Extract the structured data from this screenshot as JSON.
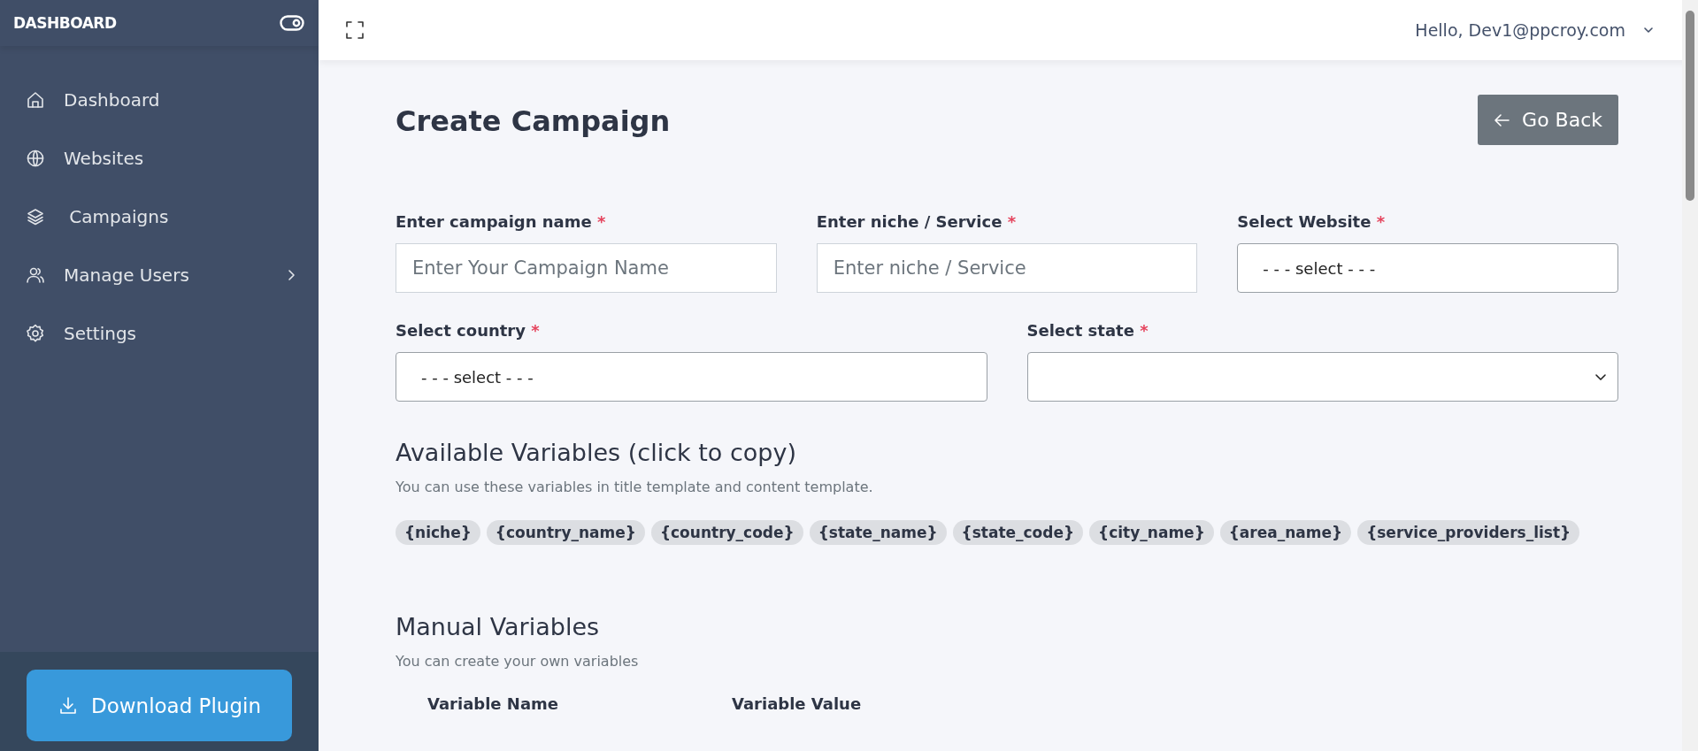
{
  "sidebar": {
    "brand": "DASHBOARD",
    "items": [
      {
        "label": "Dashboard",
        "expandable": false
      },
      {
        "label": "Websites",
        "expandable": false
      },
      {
        "label": " Campaigns",
        "expandable": false
      },
      {
        "label": "Manage Users",
        "expandable": true
      },
      {
        "label": "Settings",
        "expandable": false
      }
    ],
    "download_button": "Download Plugin"
  },
  "header": {
    "greeting": "Hello, Dev1@ppcroy.com"
  },
  "page": {
    "title": "Create Campaign",
    "back_button": "Go Back",
    "form_rows": [
      [
        {
          "label": "Enter campaign name",
          "mark": "*",
          "kind": "input",
          "placeholder": "Enter Your Campaign Name"
        },
        {
          "label": "Enter niche / Service",
          "mark": "*",
          "kind": "input",
          "placeholder": "Enter niche / Service"
        },
        {
          "label": "Select Website",
          "mark": "*",
          "kind": "select",
          "value": "- - - select - - -",
          "arrow": false
        }
      ],
      [
        {
          "label": "Select country",
          "mark": "*",
          "kind": "select",
          "value": "- - - select - - -",
          "arrow": false
        },
        {
          "label": "Select state",
          "mark": "*",
          "kind": "select",
          "arrow": true
        }
      ]
    ],
    "available_variables": {
      "title": "Available Variables (click to copy)",
      "subtitle": "You can use these variables in title template and content template.",
      "chips": [
        "{niche}",
        "{country_name}",
        "{country_code}",
        "{state_name}",
        "{state_code}",
        "{city_name}",
        "{area_name}",
        "{service_providers_list}"
      ]
    },
    "manual_variables": {
      "title": "Manual Variables",
      "subtitle": "You can create your own variables",
      "columns": [
        "Variable Name",
        "Variable Value"
      ]
    }
  }
}
